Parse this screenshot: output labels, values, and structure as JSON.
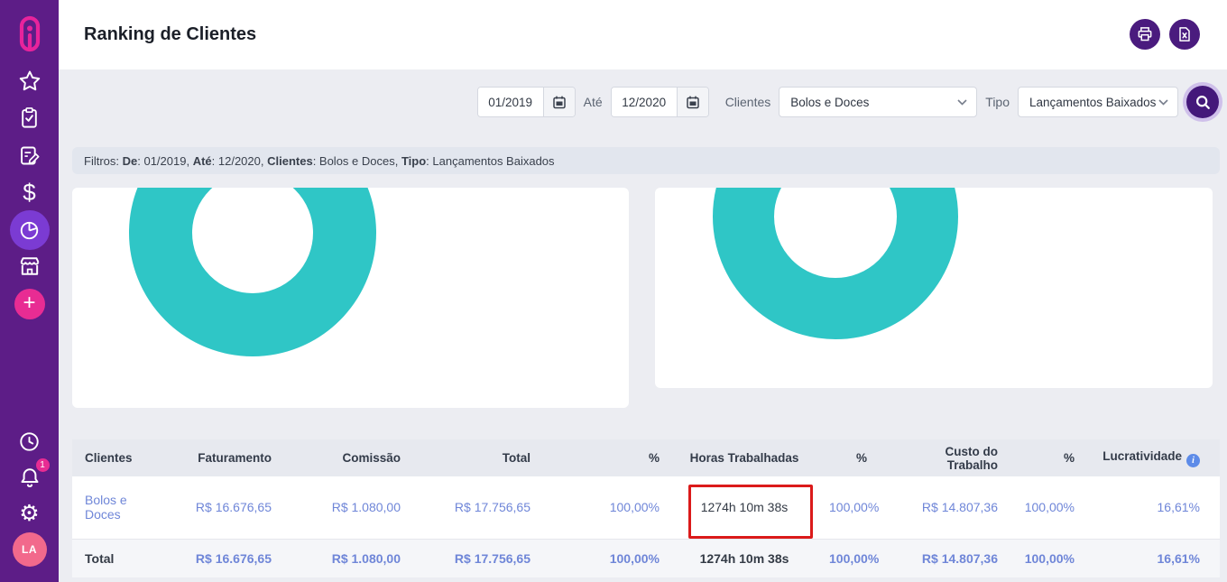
{
  "app": {
    "sidebar_icons": [
      "paperclip-logo",
      "star",
      "clipboard-check",
      "document-edit",
      "dollar",
      "pie-chart-active",
      "store",
      "plus",
      "clock",
      "bell",
      "gear",
      "avatar"
    ],
    "notification_count": "1",
    "avatar_initials": "LA",
    "plus_glyph": "+",
    "gear_glyph": "⚙",
    "dollar_glyph": "$"
  },
  "header": {
    "title": "Ranking de Clientes",
    "actions": [
      "print",
      "export-excel"
    ]
  },
  "filters": {
    "date_from": "01/2019",
    "to_label": "Até",
    "date_to": "12/2020",
    "clients_label": "Clientes",
    "clients_value": "Bolos e Doces",
    "type_label": "Tipo",
    "type_value": "Lançamentos Baixados"
  },
  "summary": {
    "s1": "Filtros: ",
    "b1": "De",
    "s2": ": 01/2019, ",
    "b2": "Até",
    "s3": ": 12/2020, ",
    "b3": "Clientes",
    "s4": ": Bolos e Doces, ",
    "b4": "Tipo",
    "s5": ": Lançamentos Baixados"
  },
  "chart_data": [
    {
      "type": "pie",
      "subtype": "donut",
      "segments": [
        {
          "value": 100,
          "color": "#2FC6C6"
        }
      ],
      "title": "",
      "legend": false,
      "layout_note": "full single-color ring, top of ring cropped by page scroll"
    },
    {
      "type": "pie",
      "subtype": "donut",
      "segments": [
        {
          "value": 100,
          "color": "#2FC6C6"
        }
      ],
      "title": "",
      "legend": false,
      "layout_note": "full single-color ring, top of ring cropped by page scroll"
    }
  ],
  "table": {
    "headers": [
      "Clientes",
      "Faturamento",
      "Comissão",
      "Total",
      "%",
      "Horas Trabalhadas",
      "%",
      "Custo do Trabalho",
      "%",
      "Lucratividade"
    ],
    "rows": [
      {
        "cells": [
          "Bolos e Doces",
          "R$ 16.676,65",
          "R$ 1.080,00",
          "R$ 17.756,65",
          "100,00%",
          "1274h 10m 38s",
          "100,00%",
          "R$ 14.807,36",
          "100,00%",
          "16,61%"
        ]
      }
    ],
    "total": {
      "cells": [
        "Total",
        "R$ 16.676,65",
        "R$ 1.080,00",
        "R$ 17.756,65",
        "100,00%",
        "1274h 10m 38s",
        "100,00%",
        "R$ 14.807,36",
        "100,00%",
        "16,61%"
      ]
    }
  },
  "colors": {
    "sidebar": "#5D1D87",
    "sidebar_active": "#7B3BD3",
    "accent_pink": "#E82C93",
    "header_button": "#4A1B7E",
    "donut_teal": "#2FC6C6",
    "value_blue": "#6F86D8",
    "highlight_red": "#DB1A1A",
    "info_blue": "#5D8BE8"
  }
}
